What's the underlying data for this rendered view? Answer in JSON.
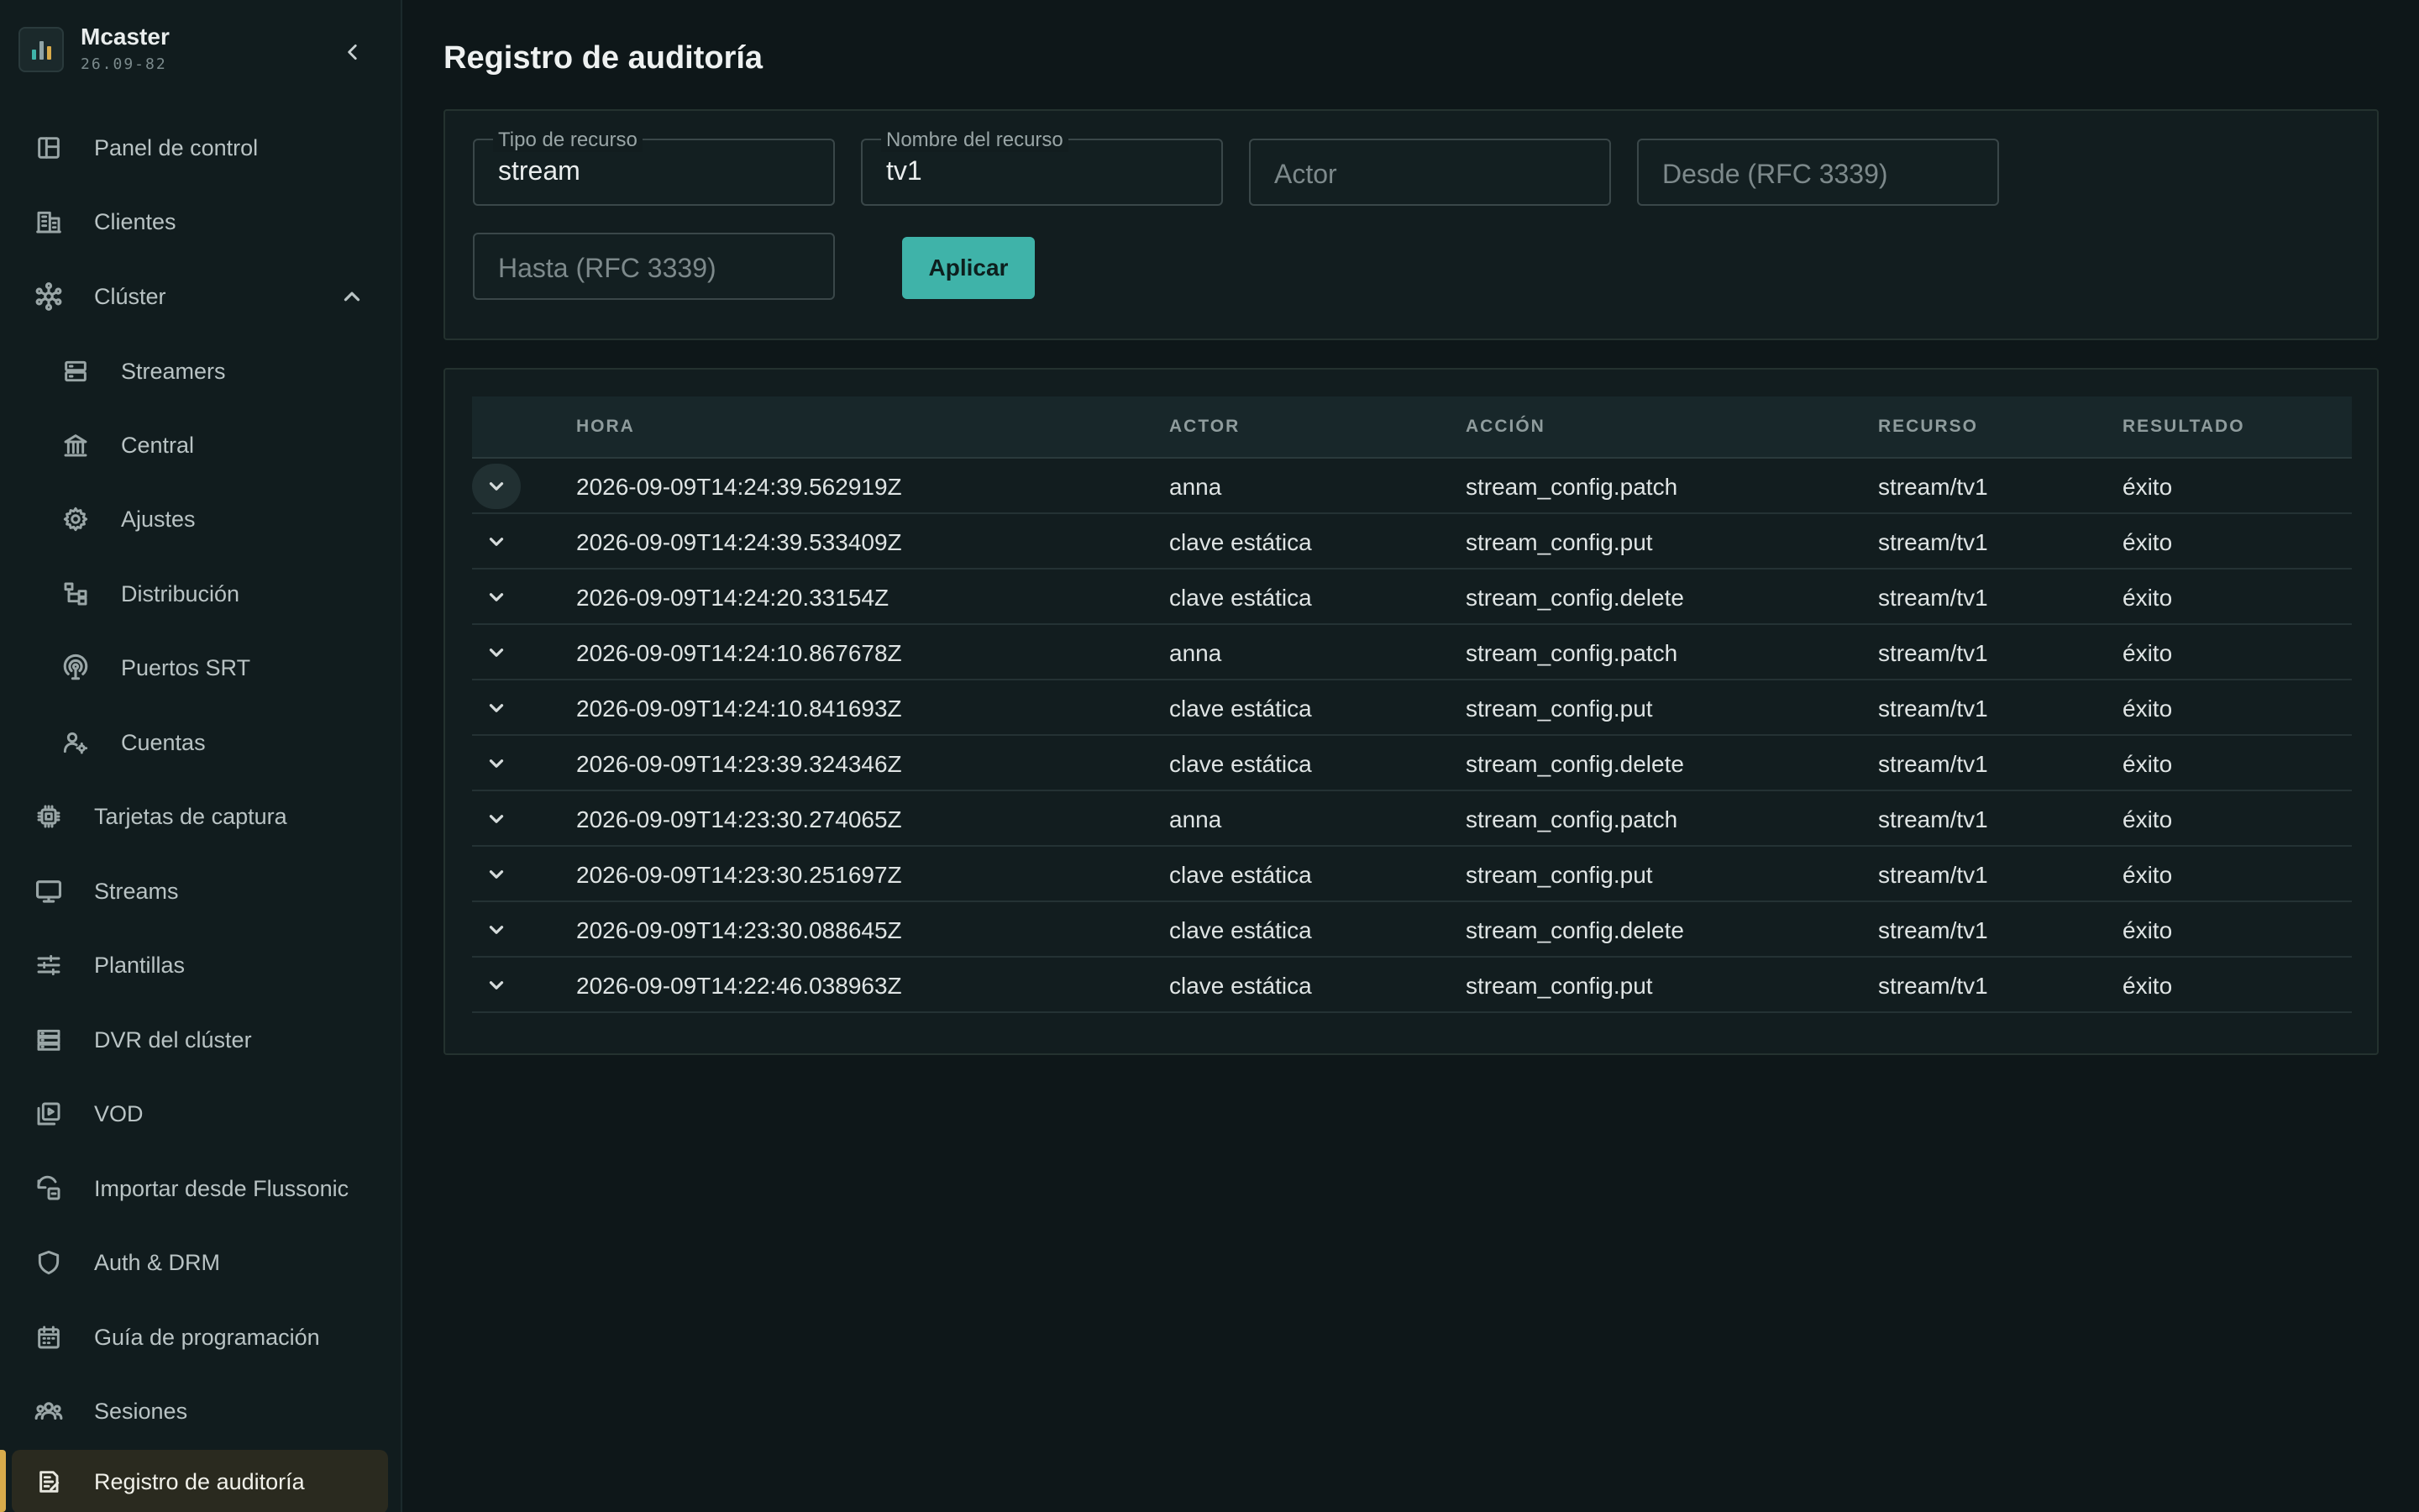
{
  "app": {
    "name": "Mcaster",
    "version": "26.09-82",
    "logo_colors": [
      "#3fb3a9",
      "#d8ab4b",
      "#8fa3a5"
    ]
  },
  "sidebar": {
    "items": [
      {
        "label": "Panel de control",
        "icon": "dashboard-icon"
      },
      {
        "label": "Clientes",
        "icon": "building-icon"
      },
      {
        "label": "Clúster",
        "icon": "cluster-icon",
        "expanded": true
      },
      {
        "label": "Streamers",
        "icon": "server-icon"
      },
      {
        "label": "Central",
        "icon": "bank-icon"
      },
      {
        "label": "Ajustes",
        "icon": "gear-icon"
      },
      {
        "label": "Distribución",
        "icon": "hierarchy-icon"
      },
      {
        "label": "Puertos SRT",
        "icon": "antenna-icon"
      },
      {
        "label": "Cuentas",
        "icon": "user-gear-icon"
      },
      {
        "label": "Tarjetas de captura",
        "icon": "chip-icon"
      },
      {
        "label": "Streams",
        "icon": "monitor-icon"
      },
      {
        "label": "Plantillas",
        "icon": "sliders-icon"
      },
      {
        "label": "DVR del clúster",
        "icon": "storage-icon"
      },
      {
        "label": "VOD",
        "icon": "video-library-icon"
      },
      {
        "label": "Importar desde Flussonic",
        "icon": "import-icon"
      },
      {
        "label": "Auth & DRM",
        "icon": "shield-icon"
      },
      {
        "label": "Guía de programación",
        "icon": "calendar-icon"
      },
      {
        "label": "Sesiones",
        "icon": "users-icon"
      },
      {
        "label": "Registro de auditoría",
        "icon": "audit-icon",
        "active": true
      }
    ]
  },
  "page": {
    "title": "Registro de auditoría"
  },
  "filters": {
    "resource_type": {
      "label": "Tipo de recurso",
      "value": "stream"
    },
    "resource_name": {
      "label": "Nombre del recurso",
      "value": "tv1"
    },
    "actor": {
      "placeholder": "Actor"
    },
    "from": {
      "placeholder": "Desde (RFC 3339)"
    },
    "to": {
      "placeholder": "Hasta (RFC 3339)"
    },
    "apply_label": "Aplicar"
  },
  "table": {
    "columns": [
      "HORA",
      "ACTOR",
      "ACCIÓN",
      "RECURSO",
      "RESULTADO"
    ],
    "rows": [
      {
        "hora": "2026-09-09T14:24:39.562919Z",
        "actor": "anna",
        "accion": "stream_config.patch",
        "recurso": "stream/tv1",
        "resultado": "éxito"
      },
      {
        "hora": "2026-09-09T14:24:39.533409Z",
        "actor": "clave estática",
        "accion": "stream_config.put",
        "recurso": "stream/tv1",
        "resultado": "éxito"
      },
      {
        "hora": "2026-09-09T14:24:20.33154Z",
        "actor": "clave estática",
        "accion": "stream_config.delete",
        "recurso": "stream/tv1",
        "resultado": "éxito"
      },
      {
        "hora": "2026-09-09T14:24:10.867678Z",
        "actor": "anna",
        "accion": "stream_config.patch",
        "recurso": "stream/tv1",
        "resultado": "éxito"
      },
      {
        "hora": "2026-09-09T14:24:10.841693Z",
        "actor": "clave estática",
        "accion": "stream_config.put",
        "recurso": "stream/tv1",
        "resultado": "éxito"
      },
      {
        "hora": "2026-09-09T14:23:39.324346Z",
        "actor": "clave estática",
        "accion": "stream_config.delete",
        "recurso": "stream/tv1",
        "resultado": "éxito"
      },
      {
        "hora": "2026-09-09T14:23:30.274065Z",
        "actor": "anna",
        "accion": "stream_config.patch",
        "recurso": "stream/tv1",
        "resultado": "éxito"
      },
      {
        "hora": "2026-09-09T14:23:30.251697Z",
        "actor": "clave estática",
        "accion": "stream_config.put",
        "recurso": "stream/tv1",
        "resultado": "éxito"
      },
      {
        "hora": "2026-09-09T14:23:30.088645Z",
        "actor": "clave estática",
        "accion": "stream_config.delete",
        "recurso": "stream/tv1",
        "resultado": "éxito"
      },
      {
        "hora": "2026-09-09T14:22:46.038963Z",
        "actor": "clave estática",
        "accion": "stream_config.put",
        "recurso": "stream/tv1",
        "resultado": "éxito"
      }
    ]
  },
  "colors": {
    "accent": "#3fb3a9",
    "active_marker": "#d8ab4b",
    "background": "#0e1719"
  }
}
